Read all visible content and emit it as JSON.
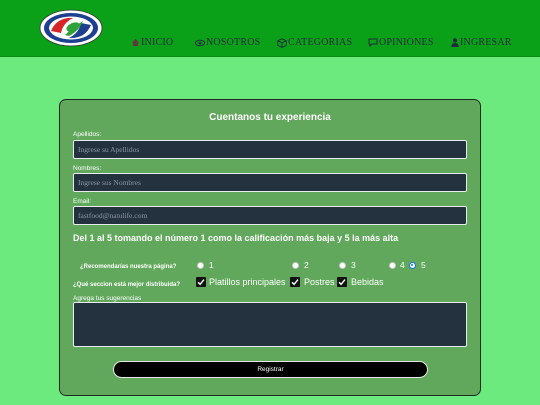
{
  "nav": {
    "items": [
      {
        "label": "INICIO",
        "icon": "home-icon"
      },
      {
        "label": "NOSOTROS",
        "icon": "eye-icon"
      },
      {
        "label": "CATEGORIAS",
        "icon": "box-icon"
      },
      {
        "label": "OPINIONES",
        "icon": "chat-icon"
      },
      {
        "label": "INGRESAR",
        "icon": "user-icon"
      }
    ]
  },
  "form": {
    "title": "Cuentanos tu experiencia",
    "apellidos": {
      "label": "Apellidos:",
      "placeholder": "Ingrese su Apellidos"
    },
    "nombres": {
      "label": "Nombres:",
      "placeholder": "Ingrese sus Nombres"
    },
    "email": {
      "label": "Email:",
      "placeholder": "fastfood@natulife.com"
    },
    "scale_text": "Del 1 al 5 tomando el número 1 como la calificación más baja y 5 la más alta",
    "recommend": {
      "question": "¿Recomendarías nuestra página?",
      "options": [
        "1",
        "2",
        "3",
        "4",
        "5"
      ],
      "selected": "5"
    },
    "sections": {
      "question": "¿Qué seccion está mejor distribuida?",
      "options": [
        "Platillos principales",
        "Postres",
        "Bebidas"
      ],
      "checked": [
        true,
        true,
        true
      ]
    },
    "suggestions_label": "Agrega tus sugerencias",
    "submit_label": "Registrar"
  },
  "colors": {
    "page_bg": "#6dea7d",
    "header_bg": "#0aa119",
    "card_bg": "#61a85c",
    "input_bg": "#243240",
    "button_bg": "#000000"
  }
}
